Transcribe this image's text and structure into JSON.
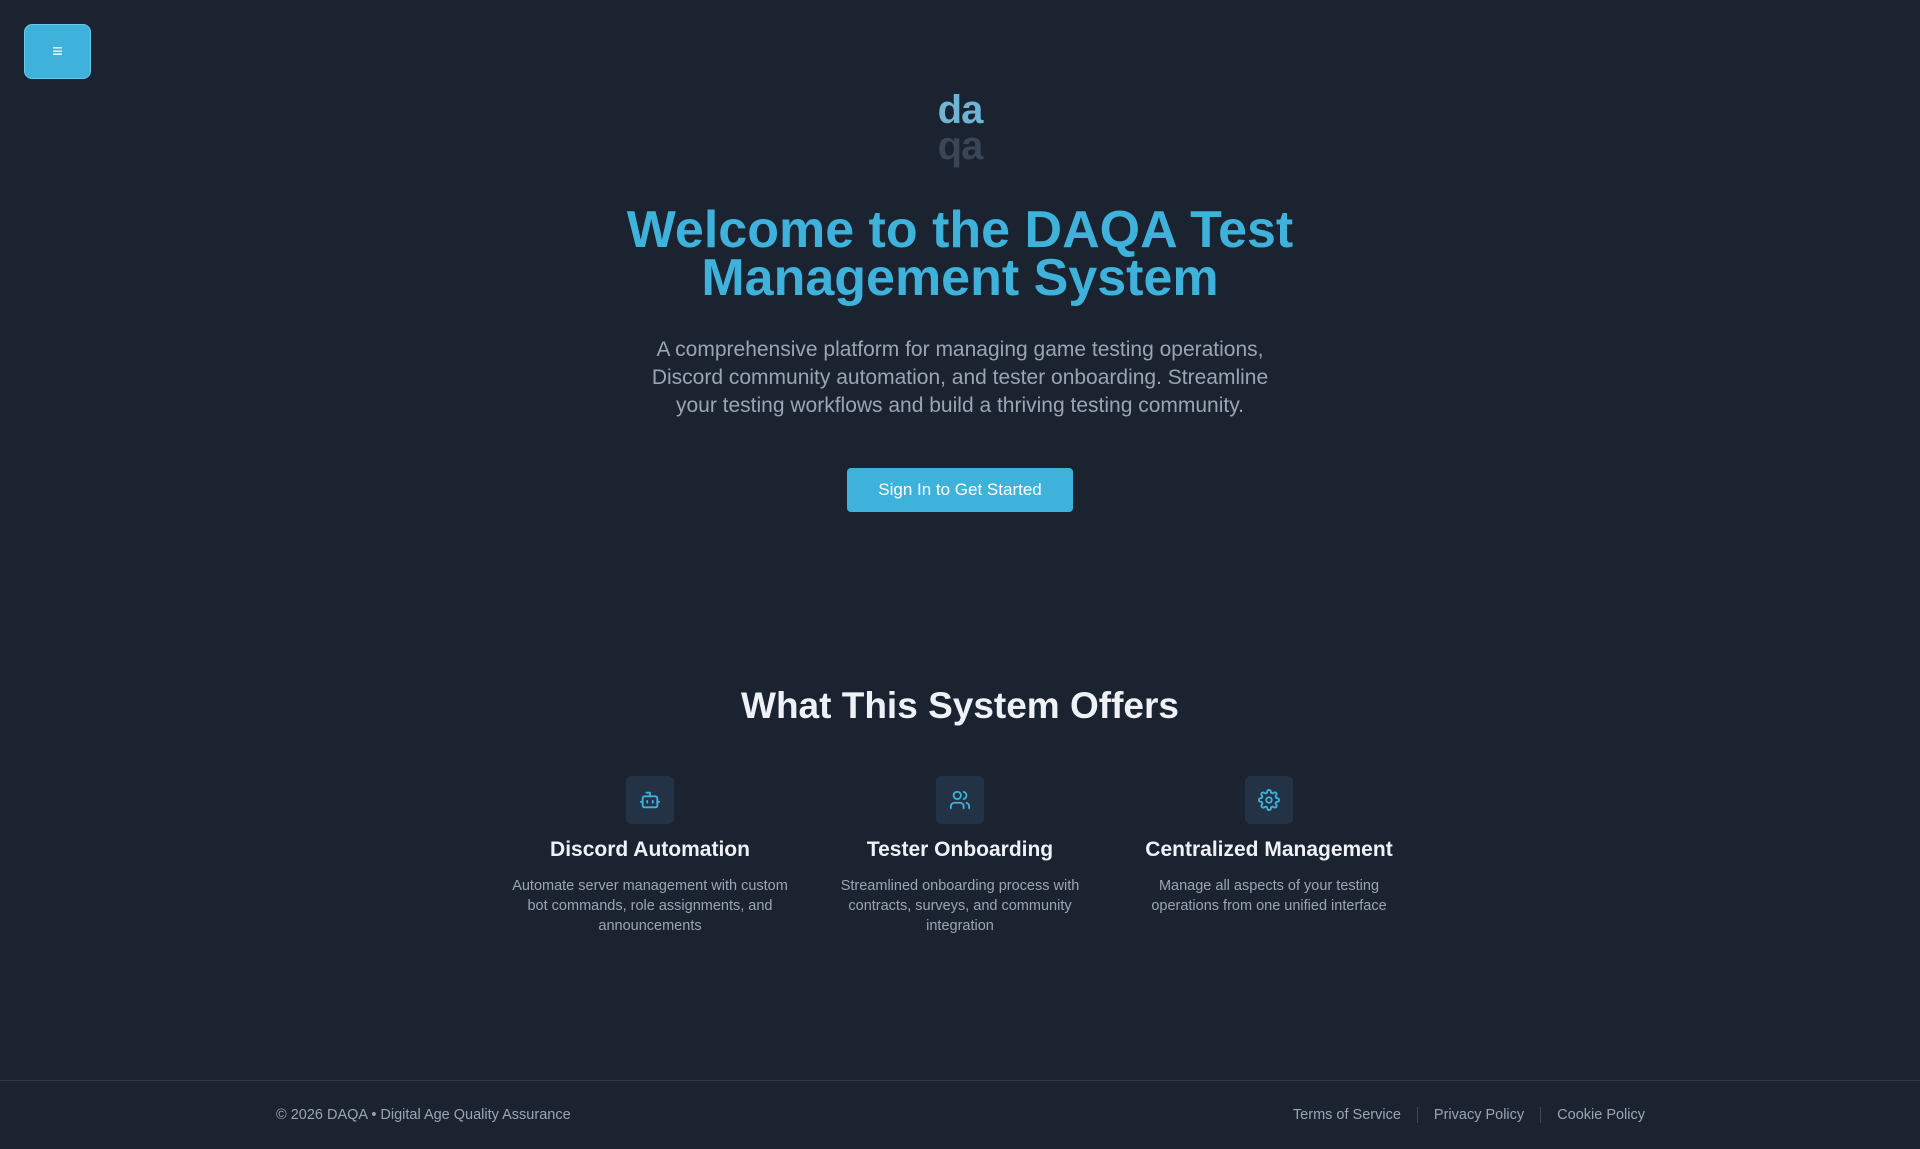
{
  "menu": {
    "label": "≡"
  },
  "logo": {
    "top": "da",
    "bottom": "qa"
  },
  "hero": {
    "title": "Welcome to the DAQA Test Management System",
    "subtitle": "A comprehensive platform for managing game testing operations, Discord community automation, and tester onboarding. Streamline your testing workflows and build a thriving testing community.",
    "cta": "Sign In to Get Started"
  },
  "offers": {
    "title": "What This System Offers",
    "features": [
      {
        "icon": "bot-icon",
        "title": "Discord Automation",
        "desc": "Automate server management with custom bot commands, role assignments, and announcements"
      },
      {
        "icon": "users-icon",
        "title": "Tester Onboarding",
        "desc": "Streamlined onboarding process with contracts, surveys, and community integration"
      },
      {
        "icon": "gear-icon",
        "title": "Centralized Management",
        "desc": "Manage all aspects of your testing operations from one unified interface"
      }
    ]
  },
  "footer": {
    "copyright": "© 2026 DAQA • Digital Age Quality Assurance",
    "links": [
      "Terms of Service",
      "Privacy Policy",
      "Cookie Policy"
    ]
  },
  "colors": {
    "accent": "#3eb2db",
    "background": "#1b2331"
  }
}
